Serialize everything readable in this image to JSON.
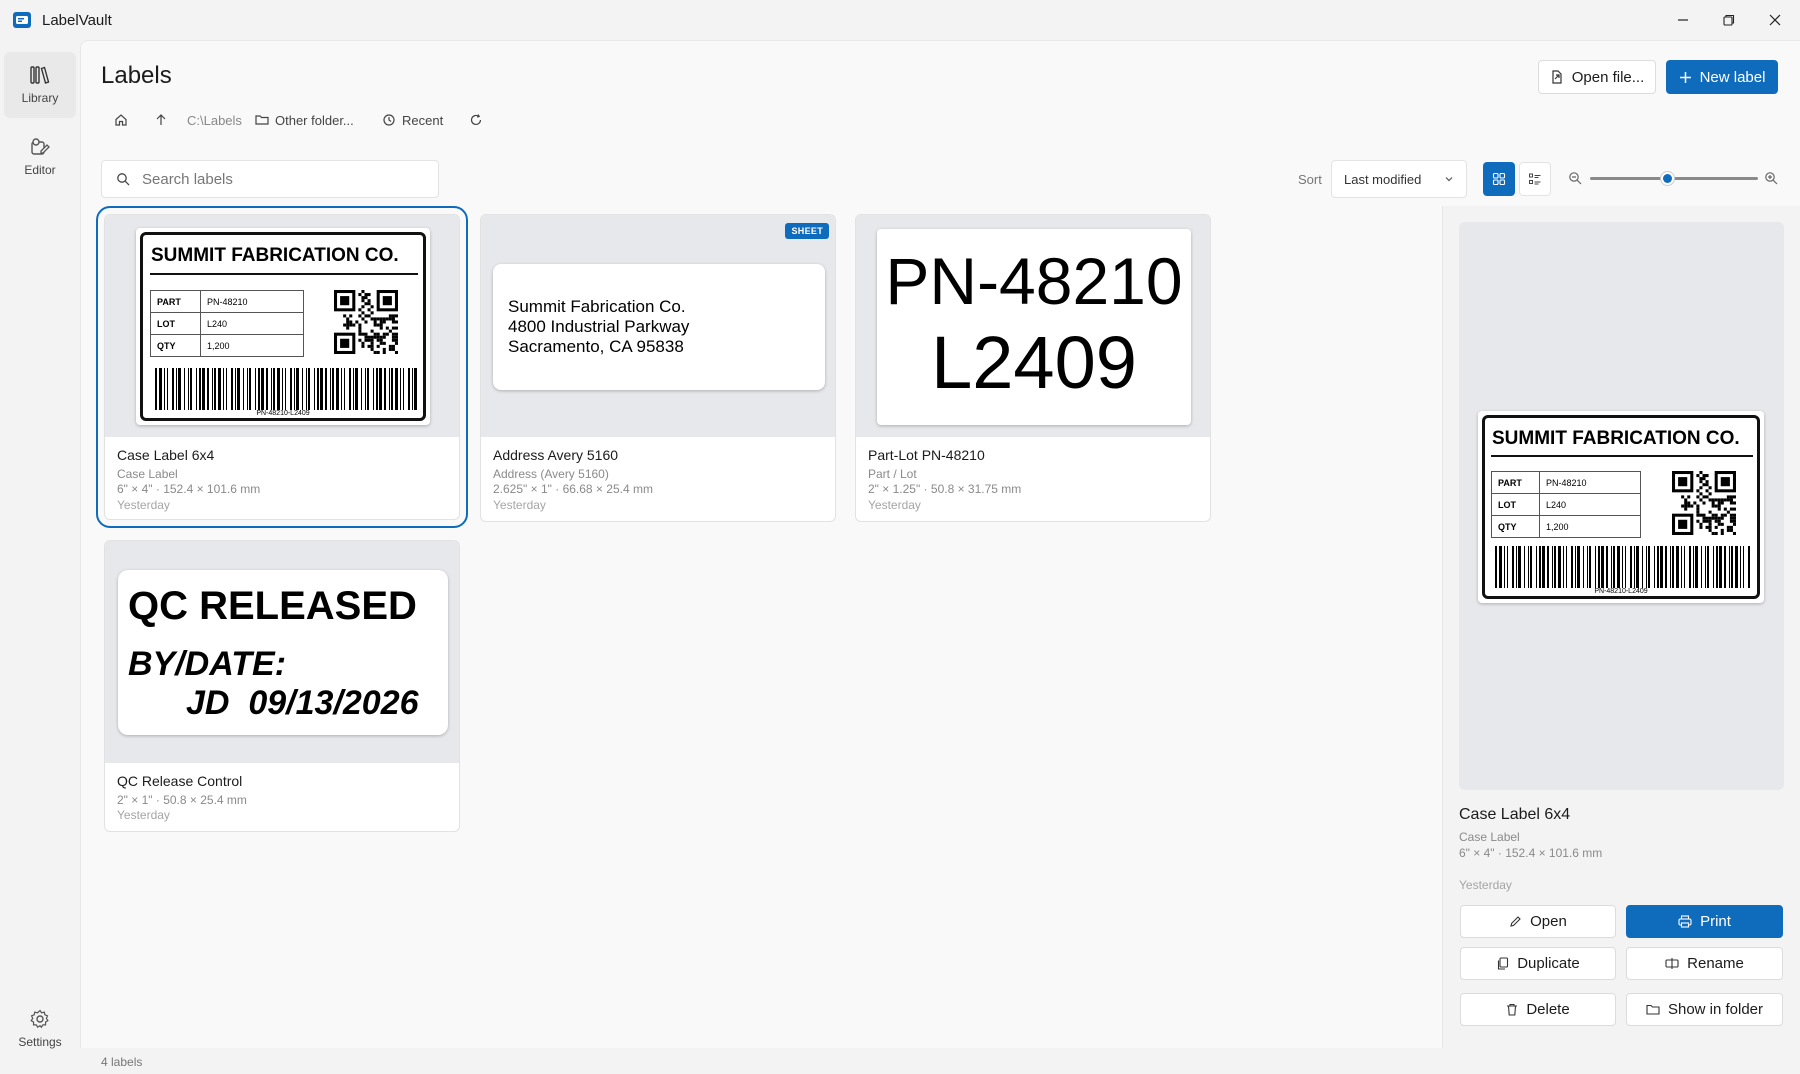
{
  "app": {
    "title": "LabelVault"
  },
  "nav": {
    "library": "Library",
    "editor": "Editor",
    "settings": "Settings"
  },
  "header": {
    "title": "Labels",
    "open_file": "Open file...",
    "new_label": "New label"
  },
  "breadcrumb": {
    "path": "C:\\Labels",
    "other_folder": "Other folder...",
    "recent": "Recent"
  },
  "search": {
    "placeholder": "Search labels"
  },
  "sort": {
    "label": "Sort",
    "value": "Last modified"
  },
  "zoom": {
    "level": 0.46
  },
  "cards": [
    {
      "name": "Case Label 6x4",
      "type": "Case Label",
      "size": "6\" × 4\"  ·  152.4 × 101.6 mm",
      "date": "Yesterday"
    },
    {
      "name": "Address Avery 5160",
      "type": "Address (Avery 5160)",
      "size": "2.625\" × 1\"  ·  66.68 × 25.4 mm",
      "date": "Yesterday",
      "badge": "SHEET"
    },
    {
      "name": "Part-Lot PN-48210",
      "type": "Part / Lot",
      "size": "2\" × 1.25\"  ·  50.8 × 31.75 mm",
      "date": "Yesterday"
    },
    {
      "name": "QC Release Control",
      "size": "2\" × 1\"  ·  50.8 × 25.4 mm",
      "date": "Yesterday"
    }
  ],
  "labels": {
    "case": {
      "company": "SUMMIT FABRICATION CO.",
      "rows": [
        {
          "k": "PART",
          "v": "PN-48210"
        },
        {
          "k": "LOT",
          "v": "L240"
        },
        {
          "k": "QTY",
          "v": "1,200"
        }
      ],
      "barcode_text": "PN-48210-L2409"
    },
    "address": {
      "line1": "Summit Fabrication Co.",
      "line2": "4800 Industrial Parkway",
      "line3": "Sacramento, CA 95838"
    },
    "partlot": {
      "line1": "PN-48210",
      "line2": "L2409"
    },
    "qc": {
      "line1": "QC RELEASED",
      "line2": "BY/DATE:",
      "line3": "JD  09/13/2026"
    }
  },
  "details": {
    "name": "Case Label 6x4",
    "type": "Case Label",
    "size": "6\" × 4\"  ·  152.4 × 101.6 mm",
    "date": "Yesterday",
    "actions": {
      "open": "Open",
      "print": "Print",
      "duplicate": "Duplicate",
      "rename": "Rename",
      "delete": "Delete",
      "show_in_folder": "Show in folder"
    }
  },
  "status": {
    "count": "4 labels"
  },
  "colors": {
    "accent": "#0f6cbd"
  }
}
